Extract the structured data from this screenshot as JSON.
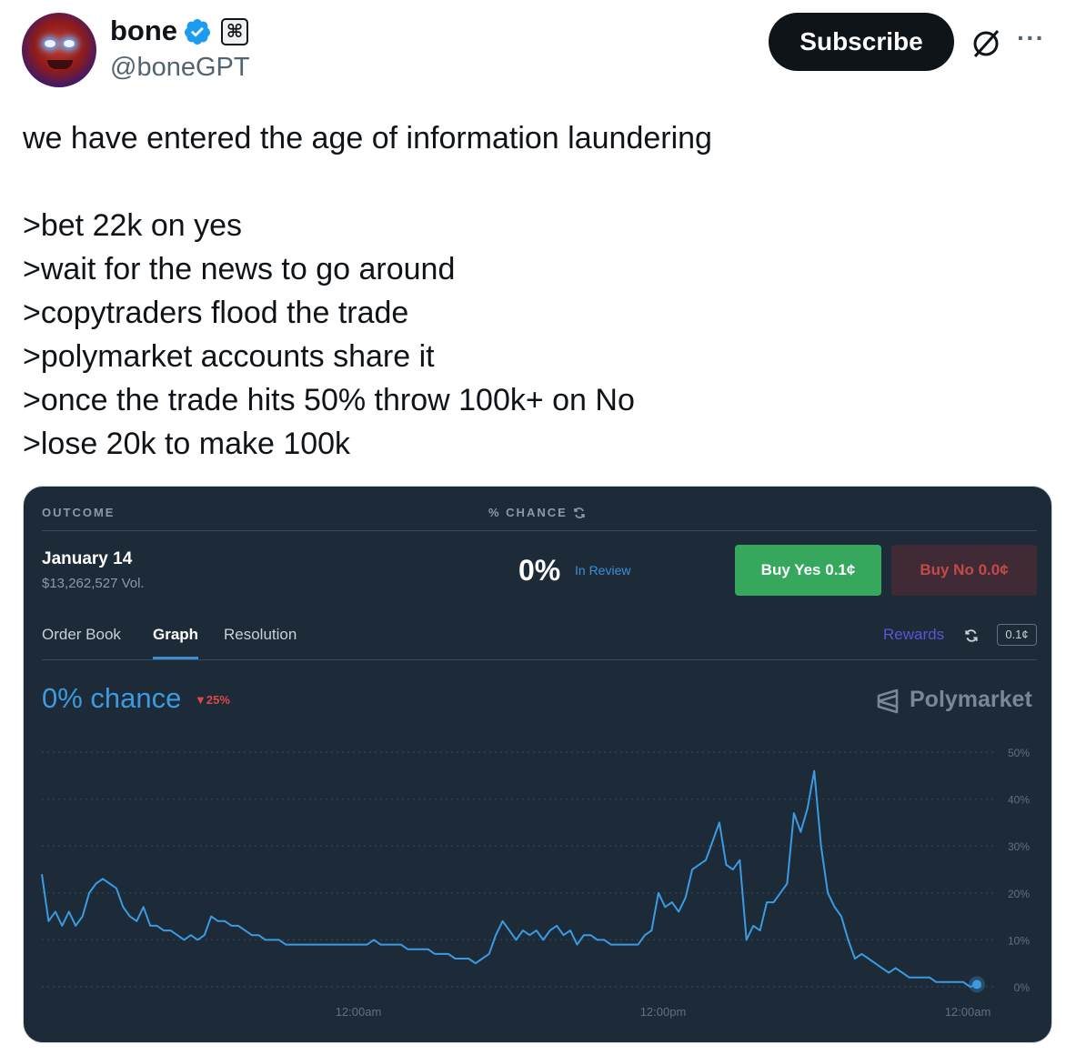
{
  "author": {
    "name": "bone",
    "handle": "@boneGPT",
    "badge_glyph": "⌘"
  },
  "actions": {
    "subscribe_label": "Subscribe",
    "more_label": "···"
  },
  "tweet": {
    "lines": [
      "we have entered the age of information laundering",
      "",
      ">bet 22k on yes",
      ">wait for the news to go around",
      ">copytraders flood the trade",
      ">polymarket accounts share it",
      ">once the trade hits 50% throw 100k+ on No",
      ">lose 20k to make 100k"
    ]
  },
  "market": {
    "outcome_header": "OUTCOME",
    "chance_header": "% CHANCE",
    "outcome_title": "January 14",
    "volume": "$13,262,527 Vol.",
    "chance_value": "0%",
    "status": "In Review",
    "buy_yes_label": "Buy Yes 0.1¢",
    "buy_no_label": "Buy No 0.0¢",
    "tabs": [
      "Order Book",
      "Graph",
      "Resolution"
    ],
    "active_tab": "Graph",
    "rewards_label": "Rewards",
    "rewards_value": "0.1¢",
    "chance_text": "0% chance",
    "change_text": "▼25%",
    "brand": "Polymarket",
    "colors": {
      "line": "#3b9ae0",
      "yes": "#36a85d",
      "no": "#c44a4a",
      "bg": "#1d2b39"
    }
  },
  "chart_data": {
    "type": "line",
    "x_ticks": [
      "12:00am",
      "12:00pm",
      "12:00am"
    ],
    "y_ticks": [
      "50%",
      "40%",
      "30%",
      "20%",
      "10%",
      "0%"
    ],
    "ylim": [
      0,
      50
    ],
    "series": [
      {
        "values": [
          24,
          14,
          16,
          13,
          16,
          13,
          15,
          20,
          22,
          23,
          22,
          21,
          17,
          15,
          14,
          17,
          13,
          13,
          12,
          12,
          11,
          10,
          11,
          10,
          11,
          15,
          14,
          14,
          13,
          13,
          12,
          11,
          11,
          10,
          10,
          10,
          9,
          9,
          9,
          9,
          9,
          9,
          9,
          9,
          9,
          9,
          9,
          9,
          9,
          10,
          9,
          9,
          9,
          9,
          8,
          8,
          8,
          8,
          7,
          7,
          7,
          6,
          6,
          6,
          5,
          6,
          7,
          11,
          14,
          12,
          10,
          12,
          11,
          12,
          10,
          12,
          13,
          11,
          12,
          9,
          11,
          11,
          10,
          10,
          9,
          9,
          9,
          9,
          9,
          11,
          12,
          20,
          17,
          18,
          16,
          19,
          25,
          26,
          27,
          31,
          35,
          26,
          25,
          27,
          10,
          13,
          12,
          18,
          18,
          20,
          22,
          37,
          33,
          38,
          46,
          30,
          20,
          17,
          15,
          10,
          6,
          7,
          6,
          5,
          4,
          3,
          4,
          3,
          2,
          2,
          2,
          2,
          1,
          1,
          1,
          1,
          1,
          0,
          0.5
        ]
      }
    ],
    "end_value": 0.5
  }
}
